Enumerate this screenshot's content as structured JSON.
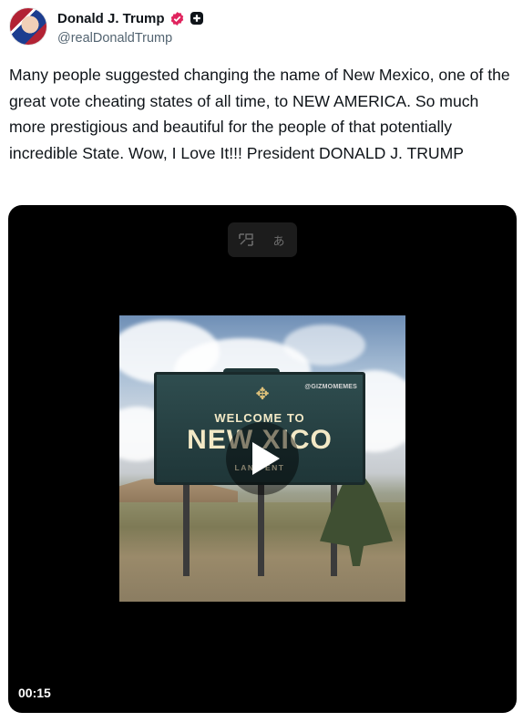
{
  "author": {
    "display_name": "Donald J. Trump",
    "handle": "@realDonaldTrump",
    "verified_icon": "verified-check-icon",
    "affiliate_icon": "plus-badge-icon"
  },
  "post": {
    "text": "Many people suggested changing the name of New Mexico, one of the great vote cheating states of all time, to NEW AMERICA. So much more prestigious and beautiful for the people of that potentially incredible State. Wow, I Love It!!! President DONALD J. TRUMP"
  },
  "video": {
    "duration": "00:15",
    "toolbar_icons": [
      "picture-in-picture-icon",
      "translate-icon"
    ],
    "translate_glyph": "あ",
    "thumbnail": {
      "watermark": "@GIZMOMEMES",
      "sign_welcome": "WELCOME TO",
      "sign_name": "NEW  XICO",
      "sign_motto": "LAND              ENT"
    },
    "play_icon": "play-icon"
  },
  "colors": {
    "verified": "#e0245e",
    "text": "#0f1419",
    "muted": "#536471",
    "video_bg": "#000000"
  }
}
